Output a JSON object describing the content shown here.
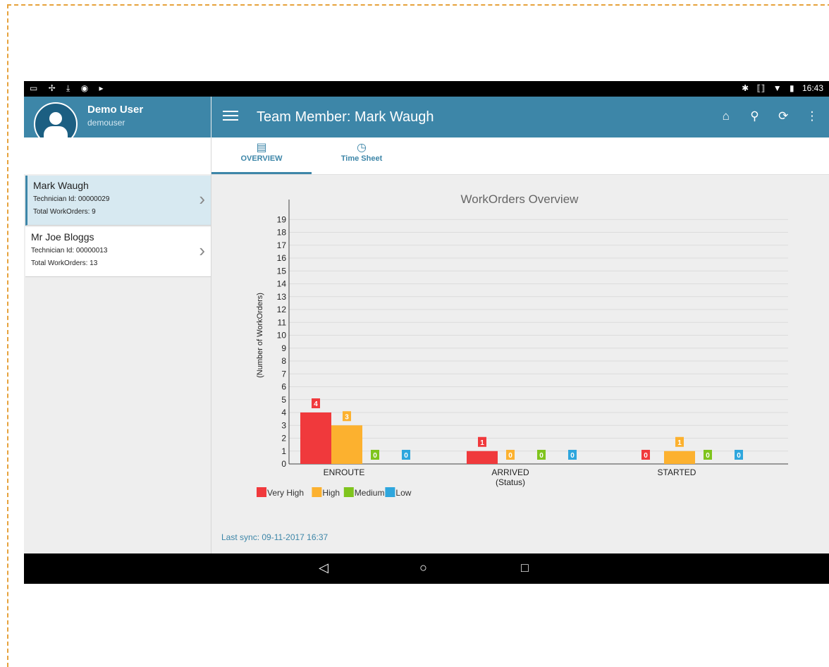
{
  "statusbar": {
    "left_icons": "▭ ✢ ⤓ ◉ ▸",
    "bluetooth": "✱",
    "vibrate": "⟦⟧",
    "wifi": "▼",
    "battery": "▮",
    "time": "16:43"
  },
  "profile": {
    "name": "Demo User",
    "login": "demouser"
  },
  "appbar": {
    "title": "Team Member: Mark Waugh",
    "home_icon": "⌂",
    "location_icon": "⚲",
    "sync_icon": "⟳",
    "more_icon": "⋮"
  },
  "members": [
    {
      "name": "Mark Waugh",
      "tech": "Technician Id: 00000029",
      "total": "Total WorkOrders: 9"
    },
    {
      "name": "Mr Joe Bloggs",
      "tech": "Technician Id: 00000013",
      "total": "Total WorkOrders: 13"
    }
  ],
  "tabs": [
    {
      "label": "OVERVIEW",
      "icon": "▤"
    },
    {
      "label": "Time Sheet",
      "icon": "◷"
    }
  ],
  "colors": {
    "very_high": "#f0393c",
    "high": "#fcb12f",
    "medium": "#7fc41d",
    "low": "#2ea6dd",
    "accent": "#3d86a8"
  },
  "chart_data": {
    "type": "bar",
    "title": "WorkOrders Overview",
    "ylabel": "(Number of WorkOrders)",
    "xlabel": "(Status)",
    "categories": [
      "ENROUTE",
      "ARRIVED",
      "STARTED"
    ],
    "series": [
      {
        "name": "Very High",
        "values": [
          4,
          1,
          0
        ]
      },
      {
        "name": "High",
        "values": [
          3,
          0,
          1
        ]
      },
      {
        "name": "Medium",
        "values": [
          0,
          0,
          0
        ]
      },
      {
        "name": "Low",
        "values": [
          0,
          0,
          0
        ]
      }
    ],
    "ylim": [
      0,
      19
    ],
    "yticks": [
      0,
      1,
      2,
      3,
      4,
      5,
      6,
      7,
      8,
      9,
      10,
      11,
      12,
      13,
      14,
      15,
      16,
      17,
      18,
      19
    ],
    "grid": true,
    "legend": "bottom-left"
  },
  "sync": "Last sync: 09-11-2017 16:37",
  "navbar": {
    "back": "◁",
    "home": "○",
    "recents": "□"
  }
}
